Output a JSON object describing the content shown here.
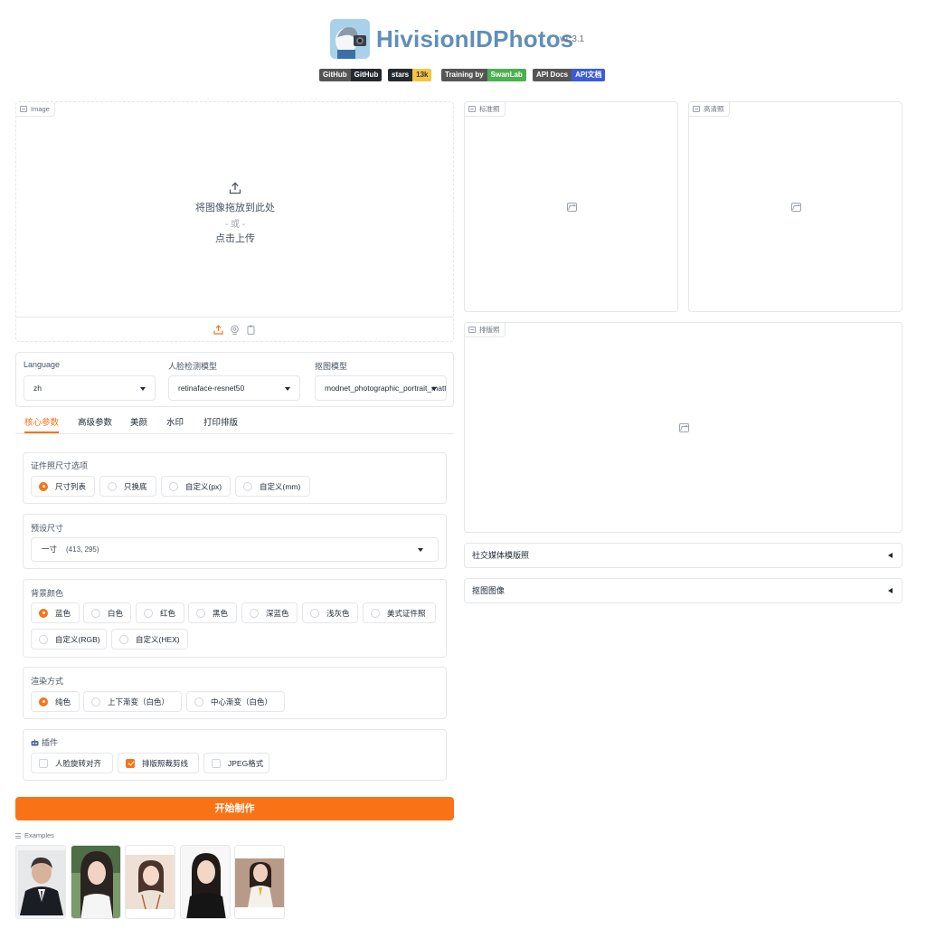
{
  "app": {
    "title": "HivisionIDPhotos",
    "version": "v1.3.1"
  },
  "badges": [
    {
      "left": "GitHub",
      "right": "GitHub",
      "left_color": "#555555",
      "right_color": "#24292e"
    },
    {
      "left": "stars",
      "right": "13k",
      "left_color": "#24292e",
      "right_color": "#f6c343"
    },
    {
      "left": "Training by",
      "right": "SwanLab",
      "left_color": "#555555",
      "right_color": "#4caf50"
    },
    {
      "left": "API Docs",
      "right": "API文档",
      "left_color": "#555555",
      "right_color": "#3b5bdb"
    }
  ],
  "upload": {
    "label": "Image",
    "line1": "将图像拖放到此处",
    "or": "- 或 -",
    "line2": "点击上传"
  },
  "outputs": {
    "standard_label": "标准照",
    "hd_label": "高清照",
    "layout_label": "排版照"
  },
  "models": {
    "language_label": "Language",
    "language_value": "zh",
    "face_label": "人脸检测模型",
    "face_value": "retinaface-resnet50",
    "matting_label": "抠图模型",
    "matting_value": "modnet_photographic_portrait_matting"
  },
  "tabs": [
    "核心参数",
    "高级参数",
    "美颜",
    "水印",
    "打印排版"
  ],
  "size_option": {
    "title": "证件照尺寸选项",
    "options": [
      "尺寸列表",
      "只换底",
      "自定义(px)",
      "自定义(mm)"
    ],
    "selected": 0
  },
  "preset": {
    "title": "预设尺寸",
    "value": "一寸",
    "dims": "(413, 295)"
  },
  "bg_color": {
    "title": "背景颜色",
    "options": [
      "蓝色",
      "白色",
      "红色",
      "黑色",
      "深蓝色",
      "浅灰色",
      "美式证件照",
      "自定义(RGB)",
      "自定义(HEX)"
    ],
    "selected": 0
  },
  "render": {
    "title": "渲染方式",
    "options": [
      "纯色",
      "上下渐变（白色）",
      "中心渐变（白色）"
    ],
    "selected": 0
  },
  "plugins": {
    "title": "插件",
    "options": [
      "人脸旋转对齐",
      "排版照裁剪线",
      "JPEG格式"
    ],
    "checked": [
      false,
      true,
      false
    ]
  },
  "start_button": "开始制作",
  "examples_label": "Examples",
  "accordions": [
    "社交媒体模版照",
    "抠图图像"
  ],
  "colors": {
    "accent": "#f97316",
    "title": "#5f8fb8"
  }
}
